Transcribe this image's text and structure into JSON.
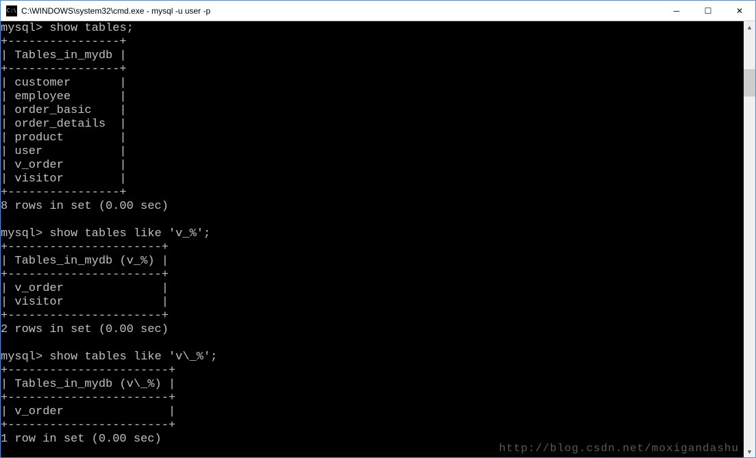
{
  "window": {
    "title": "C:\\WINDOWS\\system32\\cmd.exe - mysql  -u user -p",
    "icon_label": "cmd-icon",
    "icon_text": "C:\\"
  },
  "controls": {
    "minimize": "─",
    "maximize": "☐",
    "close": "✕"
  },
  "console": {
    "prompt": "mysql>",
    "cmd1": "show tables;",
    "sep1_top": "+----------------+",
    "hdr1": "| Tables_in_mydb |",
    "sep1_mid": "+----------------+",
    "row1_1": "| customer       |",
    "row1_2": "| employee       |",
    "row1_3": "| order_basic    |",
    "row1_4": "| order_details  |",
    "row1_5": "| product        |",
    "row1_6": "| user           |",
    "row1_7": "| v_order        |",
    "row1_8": "| visitor        |",
    "sep1_bot": "+----------------+",
    "status1": "8 rows in set (0.00 sec)",
    "cmd2": "show tables like 'v_%';",
    "sep2_top": "+----------------------+",
    "hdr2": "| Tables_in_mydb (v_%) |",
    "sep2_mid": "+----------------------+",
    "row2_1": "| v_order              |",
    "row2_2": "| visitor              |",
    "sep2_bot": "+----------------------+",
    "status2": "2 rows in set (0.00 sec)",
    "cmd3": "show tables like 'v\\_%';",
    "sep3_top": "+-----------------------+",
    "hdr3": "| Tables_in_mydb (v\\_%) |",
    "sep3_mid": "+-----------------------+",
    "row3_1": "| v_order               |",
    "sep3_bot": "+-----------------------+",
    "status3": "1 row in set (0.00 sec)"
  },
  "watermark": "http://blog.csdn.net/moxigandashu"
}
